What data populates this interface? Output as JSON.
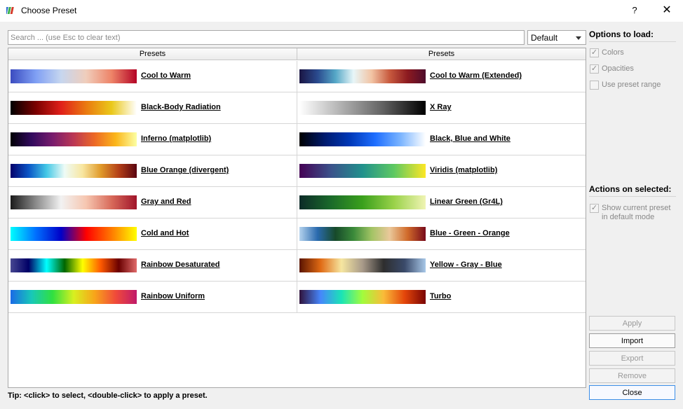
{
  "window": {
    "title": "Choose Preset",
    "help_label": "?",
    "close_label": "✕"
  },
  "search": {
    "placeholder": "Search ... (use Esc to clear text)",
    "value": ""
  },
  "filter": {
    "selected": "Default"
  },
  "table": {
    "headers": [
      "Presets",
      "Presets"
    ],
    "rows": [
      [
        {
          "label": "Cool to Warm",
          "gradient": "linear-gradient(to right,#3b4cc0,#7f9ff4,#c6d6ef,#f0cdbb,#ee8468,#b40426)"
        },
        {
          "label": "Cool to Warm (Extended)",
          "gradient": "linear-gradient(to right,#1a1543,#2a4a8e,#55a7c7,#e8f6f8,#f2c4a4,#c85a3e,#8c1a20,#4e0c2c)"
        }
      ],
      [
        {
          "label": "Black-Body Radiation",
          "gradient": "linear-gradient(to right,#000000,#7a0000,#e0201a,#ea7a10,#eac81a,#ffffff)"
        },
        {
          "label": "X Ray",
          "gradient": "linear-gradient(to right,#ffffff,#b0b0b0,#606060,#000000)"
        }
      ],
      [
        {
          "label": "Inferno (matplotlib)",
          "gradient": "linear-gradient(to right,#000004,#320a5e,#781c6d,#bb3754,#ed6925,#fbb61a,#fcffa4)"
        },
        {
          "label": "Black, Blue and White",
          "gradient": "linear-gradient(to right,#000000,#001a6e,#0038b8,#1e6eff,#7ab4ff,#ffffff)"
        }
      ],
      [
        {
          "label": "Blue Orange (divergent)",
          "gradient": "linear-gradient(to right,#04006a,#0a55c6,#44c8e6,#eefbf6,#f8e6a0,#e09a2a,#b44018,#5a0410)"
        },
        {
          "label": "Viridis (matplotlib)",
          "gradient": "linear-gradient(to right,#440154,#3b528b,#21918c,#5ec962,#fde725)"
        }
      ],
      [
        {
          "label": "Gray and Red",
          "gradient": "linear-gradient(to right,#1a1a1a,#8a8a8a,#f2f2f2,#f6c6b0,#d86a5a,#a0142a)"
        },
        {
          "label": "Linear Green (Gr4L)",
          "gradient": "linear-gradient(to right,#0c2a28,#1a6a2a,#3aa01c,#9ad24a,#f0f4b4)"
        }
      ],
      [
        {
          "label": "Cold and Hot",
          "gradient": "linear-gradient(to right,#00ffff,#0070ff,#0000c8,#ff0000,#ff7a00,#ffff00)"
        },
        {
          "label": "Blue - Green - Orange",
          "gradient": "linear-gradient(to right,#b4d2ee,#2a6aae,#174a2a,#3a8a3a,#a2c464,#eac89a,#d06a2a,#780a1a)"
        }
      ],
      [
        {
          "label": "Rainbow Desaturated",
          "gradient": "linear-gradient(to right,#474791,#000066,#00ffff,#006600,#ffff00,#ff5a00,#6a0000,#e06a6a)"
        },
        {
          "label": "Yellow - Gray - Blue",
          "gradient": "linear-gradient(to right,#5a1400,#e06a14,#f6e6a0,#a89a8a,#2e2e2e,#3a4a6a,#a8c8e8)"
        }
      ],
      [
        {
          "label": "Rainbow Uniform",
          "gradient": "linear-gradient(to right,#1a6ae6,#18c8b8,#30e040,#d8f020,#f8a41a,#f04a3a,#c01a6a)"
        },
        {
          "label": "Turbo",
          "gradient": "linear-gradient(to right,#30123b,#4686fb,#1ae4b6,#a2fc3c,#fabb39,#e4460a,#7a0403)"
        }
      ]
    ]
  },
  "options_to_load": {
    "title": "Options to load:",
    "colors": {
      "label": "Colors",
      "checked": true
    },
    "opacities": {
      "label": "Opacities",
      "checked": true
    },
    "use_preset_range": {
      "label": "Use preset range",
      "checked": false
    }
  },
  "actions": {
    "title": "Actions on selected:",
    "show_default": {
      "label": "Show current preset in default mode",
      "checked": true
    }
  },
  "buttons": {
    "apply": "Apply",
    "import": "Import",
    "export": "Export",
    "remove": "Remove",
    "close": "Close"
  },
  "tip": "Tip: <click> to select, <double-click> to apply a preset.",
  "colors": {
    "accent": "#3c8ee8",
    "background": "#f0f0f0"
  }
}
